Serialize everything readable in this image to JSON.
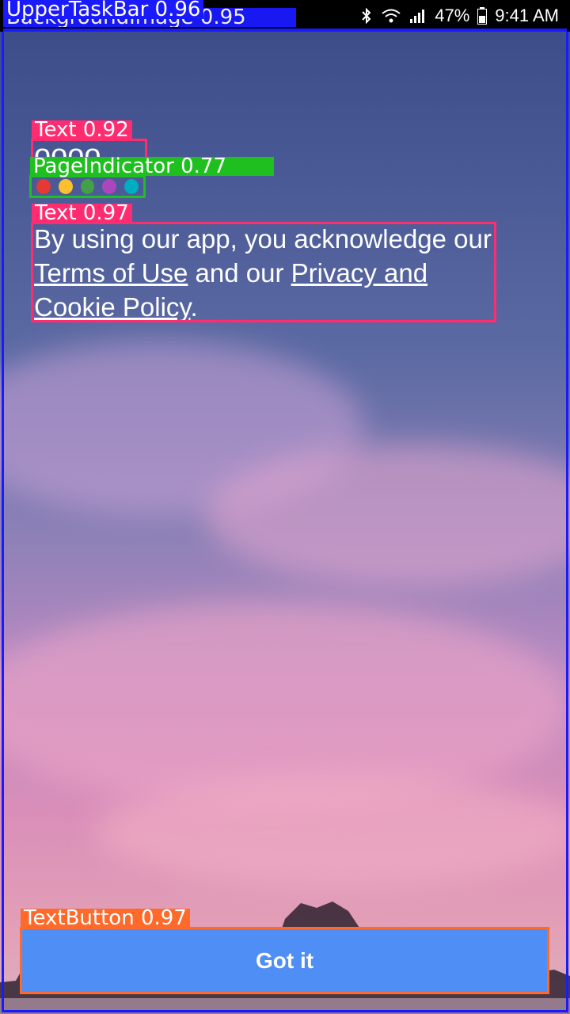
{
  "status_bar": {
    "battery": "47%",
    "time": "9:41 AM"
  },
  "logo_text": "oooo",
  "page_indicator": {
    "dots": [
      "#e53935",
      "#fbc02d",
      "#43a047",
      "#ab47bc",
      "#00acc1"
    ]
  },
  "consent": {
    "prefix": "By using our app, you acknowledge our ",
    "terms_link": "Terms of Use",
    "middle": " and our ",
    "privacy_link": "Privacy and Cookie Policy",
    "suffix": "."
  },
  "button": {
    "label": "Got it"
  },
  "annotations": {
    "upper_taskbar": "UpperTaskBar 0.96",
    "background_image": "BackgroundImage 0.95",
    "logo_text": "Text 0.92",
    "page_indicator": "PageIndicator 0.77",
    "consent_text": "Text 0.97",
    "text_button": "TextButton 0.97"
  },
  "colors": {
    "accent": "#4f8ef5",
    "annot_blue": "#1a1aff",
    "annot_pink": "#ff2d6f",
    "annot_green": "#1fbf1f",
    "annot_orange": "#ff6a2b"
  }
}
